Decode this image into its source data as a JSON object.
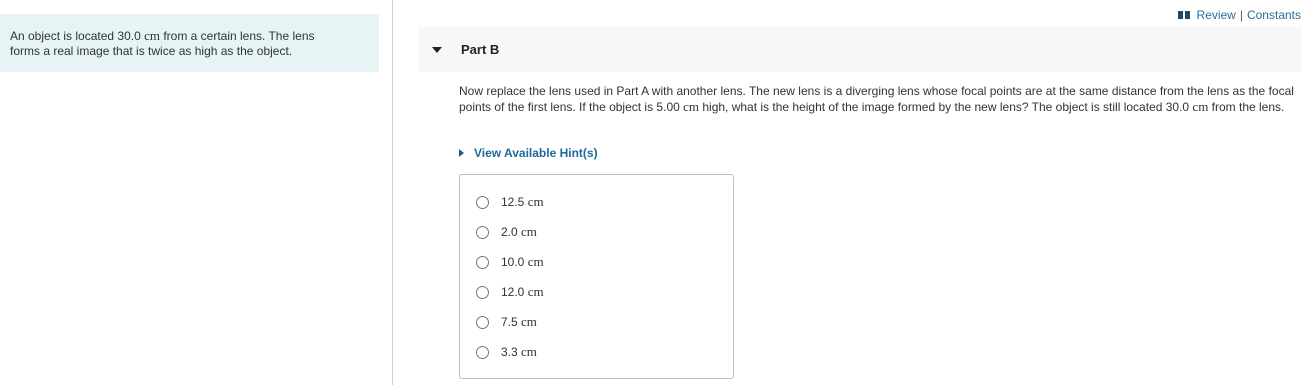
{
  "context": {
    "line1_a": "An object is located 30.0 ",
    "line1_unit": "cm",
    "line1_b": " from a certain lens. The lens",
    "line2": "forms a real image that is twice as high as the object."
  },
  "top_links": {
    "review": "Review",
    "separator": "|",
    "constants": "Constants"
  },
  "part": {
    "title": "Part B"
  },
  "question": {
    "t1": "Now replace the lens used in Part A with another lens. The new lens is a diverging lens whose focal points are at the same distance from the lens as the focal points of the first lens. If the object is 5.00 ",
    "u1": "cm",
    "t2": " high, what is the height of the image formed by the new lens? The object is still located 30.0 ",
    "u2": "cm",
    "t3": " from the lens."
  },
  "hint": {
    "label": "View Available Hint(s)"
  },
  "options": [
    {
      "value": "12.5",
      "unit": "cm"
    },
    {
      "value": "2.0",
      "unit": "cm"
    },
    {
      "value": "10.0",
      "unit": "cm"
    },
    {
      "value": "12.0",
      "unit": "cm"
    },
    {
      "value": "7.5",
      "unit": "cm"
    },
    {
      "value": "3.3",
      "unit": "cm"
    }
  ],
  "colors": {
    "context_bg": "#e6f4f5",
    "link": "#2a6e99",
    "hint": "#1d6b99"
  }
}
